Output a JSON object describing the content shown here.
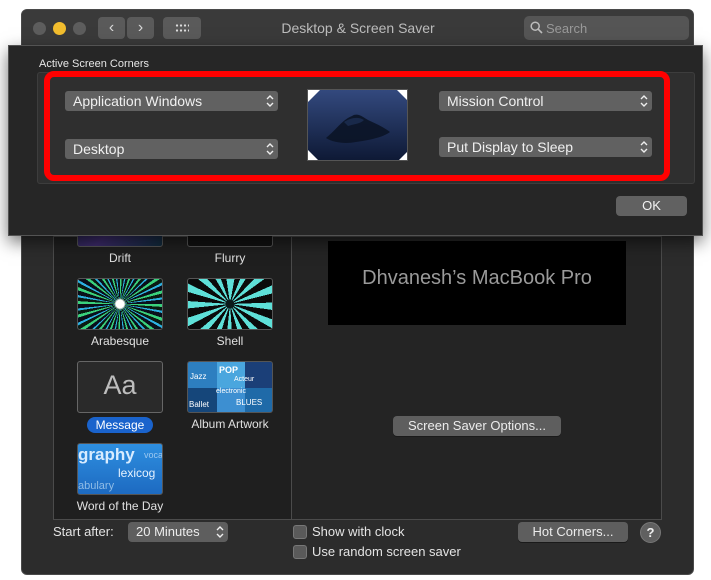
{
  "window": {
    "title": "Desktop & Screen Saver",
    "search_placeholder": "Search",
    "back_glyph": "‹",
    "forward_glyph": "›"
  },
  "screen_savers": [
    {
      "label": "Drift",
      "icon": "drift-thumbnail"
    },
    {
      "label": "Flurry",
      "icon": "flurry-thumbnail"
    },
    {
      "label": "Arabesque",
      "icon": "arabesque-thumbnail"
    },
    {
      "label": "Shell",
      "icon": "shell-thumbnail"
    },
    {
      "label": "Message",
      "icon": "message-thumbnail",
      "thumb_text": "Aa",
      "selected": true
    },
    {
      "label": "Album Artwork",
      "icon": "album-artwork-thumbnail",
      "thumb_words": [
        "POP",
        "Acteur",
        "electronic",
        "BLUES",
        "Ballet",
        "Jazz"
      ]
    },
    {
      "label": "Word of the Day",
      "icon": "word-of-the-day-thumbnail",
      "thumb_words": [
        "graphy",
        "voca",
        "lexicog",
        "abulary"
      ]
    }
  ],
  "preview": {
    "text": "Dhvanesh’s MacBook Pro",
    "options_button": "Screen Saver Options..."
  },
  "bottom": {
    "start_after_label": "Start after:",
    "start_after_value": "20 Minutes",
    "show_clock_label": "Show with clock",
    "random_label": "Use random screen saver",
    "hot_corners_button": "Hot Corners...",
    "help_glyph": "?"
  },
  "hot_corners_sheet": {
    "title": "Active Screen Corners",
    "top_left": "Application Windows",
    "bottom_left": "Desktop",
    "top_right": "Mission Control",
    "bottom_right": "Put Display to Sleep",
    "ok_button": "OK"
  },
  "colors": {
    "highlight": "#ff0000",
    "selected_badge": "#1a63cc",
    "traffic_yellow": "#f2bd2e"
  }
}
